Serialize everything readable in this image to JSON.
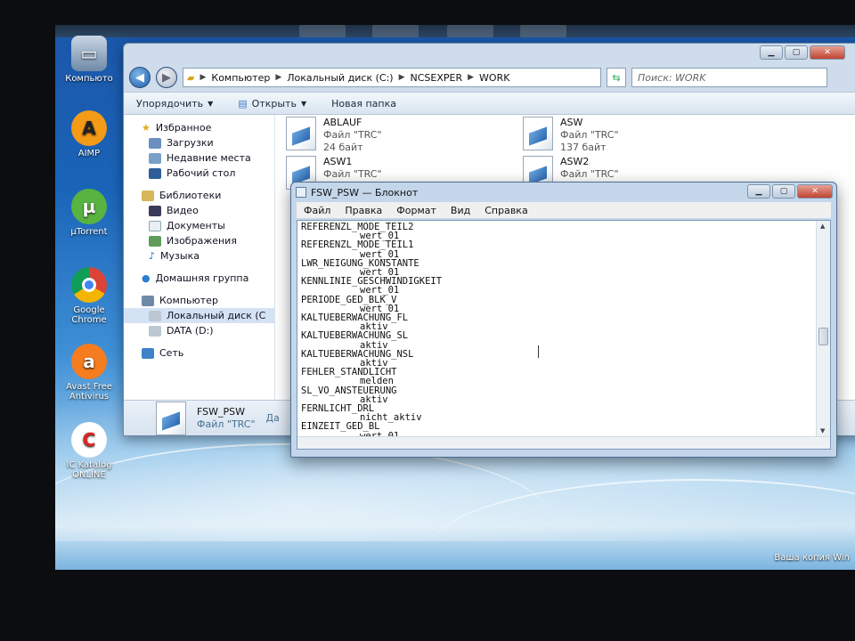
{
  "desktop": {
    "icons": [
      "Компьюто",
      "AIMP",
      "µTorrent",
      "Google Chrome",
      "Avast Free Antivirus",
      "IC Katalog ONLINE"
    ],
    "watermark": "Ваша копия Win"
  },
  "explorer": {
    "breadcrumb": [
      "Компьютер",
      "Локальный диск (C:)",
      "NCSEXPER",
      "WORK"
    ],
    "search_placeholder": "Поиск: WORK",
    "toolbar": {
      "organize": "Упорядочить",
      "open": "Открыть",
      "new_folder": "Новая папка"
    },
    "nav": {
      "favorites": "Избранное",
      "downloads": "Загрузки",
      "recent": "Недавние места",
      "desktop": "Рабочий стол",
      "libraries": "Библиотеки",
      "video": "Видео",
      "documents": "Документы",
      "images": "Изображения",
      "music": "Музыка",
      "homegroup": "Домашняя группа",
      "computer": "Компьютер",
      "local_disk": "Локальный диск (C",
      "data_disk": "DATA (D:)",
      "network": "Сеть"
    },
    "files": [
      {
        "name": "ABLAUF",
        "type": "Файл \"TRC\"",
        "size": "24 байт"
      },
      {
        "name": "ASW",
        "type": "Файл \"TRC\"",
        "size": "137 байт"
      },
      {
        "name": "ASW1",
        "type": "Файл \"TRC\"",
        "size": ""
      },
      {
        "name": "ASW2",
        "type": "Файл \"TRC\"",
        "size": ""
      }
    ],
    "details": {
      "name": "FSW_PSW",
      "type": "Файл \"TRC\"",
      "extra": "Да"
    }
  },
  "notepad": {
    "title": "FSW_PSW — Блокнот",
    "menu": [
      "Файл",
      "Правка",
      "Формат",
      "Вид",
      "Справка"
    ],
    "lines": [
      {
        "key": "REFERENZL_MODE_TEIL2",
        "value": "wert_01"
      },
      {
        "key": "REFERENZL_MODE_TEIL1",
        "value": "wert_01"
      },
      {
        "key": "LWR_NEIGUNG_KONSTANTE",
        "value": "wert_01"
      },
      {
        "key": "KENNLINIE_GESCHWINDIGKEIT",
        "value": "wert_01"
      },
      {
        "key": "PERIODE_GED_BLK_V",
        "value": "wert_01"
      },
      {
        "key": "KALTUEBERWACHUNG_FL",
        "value": "aktiv"
      },
      {
        "key": "KALTUEBERWACHUNG_SL",
        "value": "aktiv"
      },
      {
        "key": "KALTUEBERWACHUNG_NSL",
        "value": "aktiv"
      },
      {
        "key": "FEHLER_STANDLICHT",
        "value": "melden"
      },
      {
        "key": "SL_VO_ANSTEUERUNG",
        "value": "aktiv"
      },
      {
        "key": "FERNLICHT_DRL",
        "value": "nicht_aktiv"
      },
      {
        "key": "EINZEIT_GED_BL",
        "value": "wert_01"
      }
    ]
  }
}
